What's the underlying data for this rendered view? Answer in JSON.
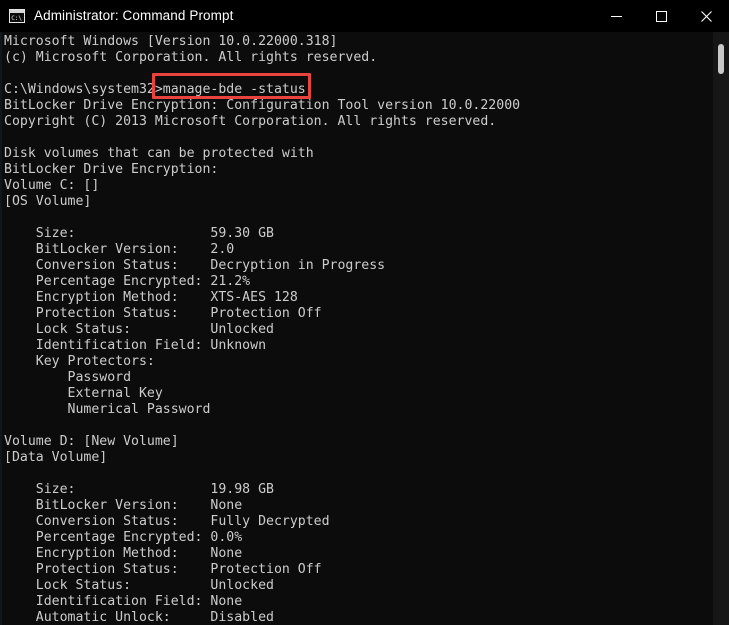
{
  "window": {
    "title": "Administrator: Command Prompt",
    "icon": "command-prompt-icon",
    "icon_label": "C:\\",
    "background_color": "#0c0c0c",
    "titlebar_color": "#000000",
    "text_color": "#cccccc"
  },
  "controls": {
    "minimize": "—",
    "maximize": "□",
    "close": "✕"
  },
  "annotation": {
    "shape": "rectangle",
    "color": "#e8433f",
    "target_text": "manage-bde -status"
  },
  "scrollbar": {
    "thumb_position_percent": 2,
    "thumb_size_percent": 5
  },
  "console": {
    "lines": [
      "Microsoft Windows [Version 10.0.22000.318]",
      "(c) Microsoft Corporation. All rights reserved.",
      "",
      "C:\\Windows\\system32>manage-bde -status",
      "BitLocker Drive Encryption: Configuration Tool version 10.0.22000",
      "Copyright (C) 2013 Microsoft Corporation. All rights reserved.",
      "",
      "Disk volumes that can be protected with",
      "BitLocker Drive Encryption:",
      "Volume C: []",
      "[OS Volume]",
      "",
      "    Size:                 59.30 GB",
      "    BitLocker Version:    2.0",
      "    Conversion Status:    Decryption in Progress",
      "    Percentage Encrypted: 21.2%",
      "    Encryption Method:    XTS-AES 128",
      "    Protection Status:    Protection Off",
      "    Lock Status:          Unlocked",
      "    Identification Field: Unknown",
      "    Key Protectors:",
      "        Password",
      "        External Key",
      "        Numerical Password",
      "",
      "Volume D: [New Volume]",
      "[Data Volume]",
      "",
      "    Size:                 19.98 GB",
      "    BitLocker Version:    None",
      "    Conversion Status:    Fully Decrypted",
      "    Percentage Encrypted: 0.0%",
      "    Encryption Method:    None",
      "    Protection Status:    Protection Off",
      "    Lock Status:          Unlocked",
      "    Identification Field: None",
      "    Automatic Unlock:     Disabled"
    ],
    "prompt": "C:\\Windows\\system32>",
    "command": "manage-bde -status",
    "tool_name": "BitLocker Drive Encryption: Configuration Tool",
    "tool_version": "10.0.22000",
    "volumes": [
      {
        "label": "Volume C: []",
        "type": "[OS Volume]",
        "size": "59.30 GB",
        "bitlocker_version": "2.0",
        "conversion_status": "Decryption in Progress",
        "percentage_encrypted": "21.2%",
        "encryption_method": "XTS-AES 128",
        "protection_status": "Protection Off",
        "lock_status": "Unlocked",
        "identification_field": "Unknown",
        "key_protectors": [
          "Password",
          "External Key",
          "Numerical Password"
        ]
      },
      {
        "label": "Volume D: [New Volume]",
        "type": "[Data Volume]",
        "size": "19.98 GB",
        "bitlocker_version": "None",
        "conversion_status": "Fully Decrypted",
        "percentage_encrypted": "0.0%",
        "encryption_method": "None",
        "protection_status": "Protection Off",
        "lock_status": "Unlocked",
        "identification_field": "None",
        "automatic_unlock": "Disabled"
      }
    ]
  }
}
